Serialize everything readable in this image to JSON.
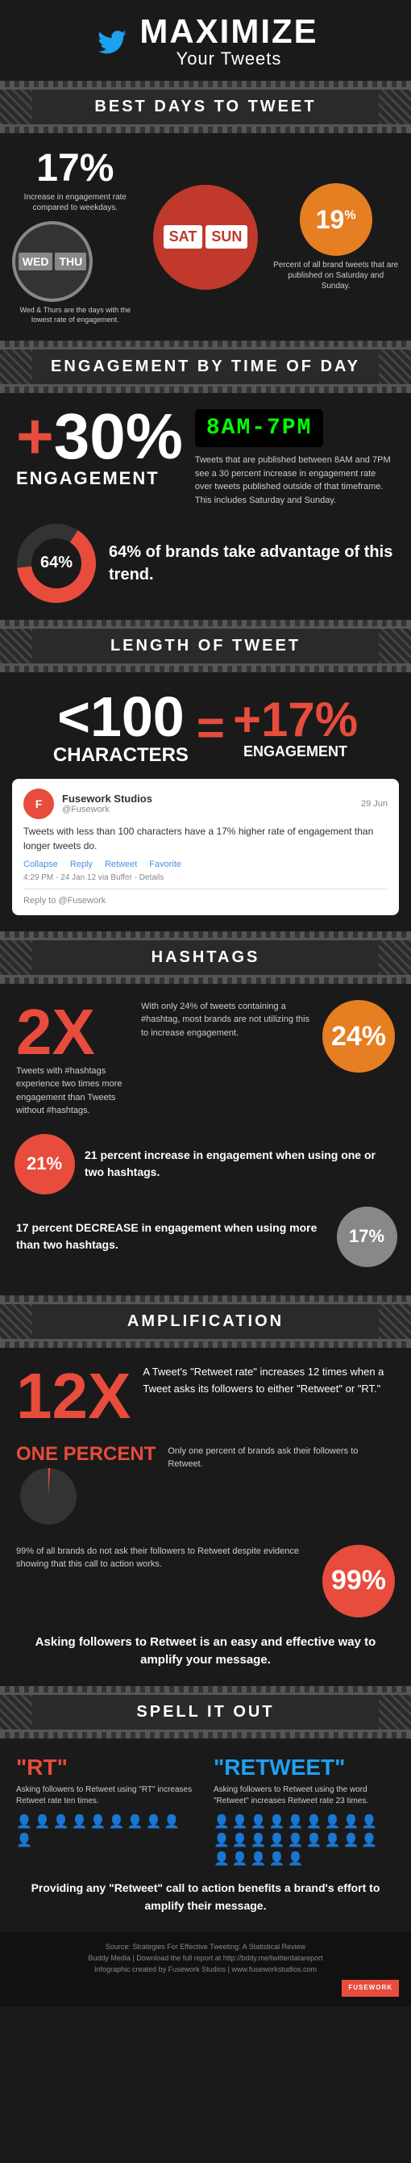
{
  "header": {
    "title": "MAXIMIZE",
    "subtitle": "Your Tweets"
  },
  "sections": {
    "best_days": {
      "banner": "BEST DAYS TO TWEET",
      "stat1_pct": "17%",
      "stat1_label": "Increase in engagement rate compared to weekdays.",
      "days_highlight": [
        "SAT",
        "SUN"
      ],
      "days_low": [
        "WED",
        "THU"
      ],
      "low_label": "Wed & Thurs are the days with the lowest rate of engagement.",
      "stat2_pct": "19%",
      "stat2_label": "Percent of all brand tweets that are published on Saturday and Sunday."
    },
    "engagement_time": {
      "banner": "ENGAGEMENT BY TIME OF DAY",
      "plus": "+",
      "pct": "30%",
      "label": "ENGAGEMENT",
      "time_range": "8AM-7PM",
      "desc": "Tweets that are published between 8AM and 7PM see a 30 percent increase in engagement rate over tweets published outside of that timeframe. This includes Saturday and Sunday.",
      "brands_pct": "64%",
      "brands_text": "64% of brands take advantage of this trend."
    },
    "length": {
      "banner": "LENGTH OF TWEET",
      "chars": "<100",
      "chars_label": "CHARACTERS",
      "equals": "=",
      "engagement": "+17%",
      "engagement_label": "ENGAGEMENT",
      "tweet": {
        "name": "Fusework Studios",
        "handle": "@Fusework",
        "date": "29 Jun",
        "body": "Tweets with less than 100 characters have a 17% higher rate of engagement than longer tweets do.",
        "actions": [
          "Collapse",
          "Reply",
          "Retweet",
          "Favorite"
        ],
        "time": "4:29 PM - 24 Jan 12 via Buffer - Details",
        "reply_placeholder": "Reply to @Fusework"
      }
    },
    "hashtags": {
      "banner": "HASHTAGS",
      "two_x": "2X",
      "two_x_desc": "Tweets with #hashtags experience two times more engagement than Tweets without #hashtags.",
      "only_24_desc": "With only 24% of tweets containing a #hashtag, most brands are not utilizing this to increase engagement.",
      "pct_24": "24%",
      "arrow_up_pct": "21%",
      "arrow_up_text": "21 percent increase in engagement when using one or two hashtags.",
      "arrow_down_pct": "17%",
      "arrow_down_text": "17 percent DECREASE in engagement when using more than two hashtags."
    },
    "amplification": {
      "banner": "AMPLIFICATION",
      "twelve_x": "12X",
      "amp_desc": "A Tweet's \"Retweet rate\" increases 12 times when a Tweet asks its followers to either \"Retweet\" or \"RT.\"",
      "one_percent_label": "ONE PERCENT",
      "one_percent_desc": "Only one percent of brands ask their followers to Retweet.",
      "ninety_nine_pct": "99%",
      "ninety_nine_desc": "99% of all brands do not ask their followers to Retweet despite evidence showing that this call to action works.",
      "cta_text": "Asking followers to Retweet is an easy and effective way to amplify your message."
    },
    "spell_it_out": {
      "banner": "SPELL IT OUT",
      "term_rt": "\"RT\"",
      "rt_desc": "Asking followers to Retweet using \"RT\" increases Retweet rate ten times.",
      "term_retweet": "\"RETWEET\"",
      "retweet_desc": "Asking followers to Retweet using the word \"Retweet\" increases Retweet rate 23 times.",
      "rt_multiplier": 10,
      "retweet_multiplier": 23,
      "bottom_text": "Providing any \"Retweet\" call to action benefits a brand's effort to amplify their message."
    }
  },
  "footer": {
    "source": "Source: Strategies For Effective Tweeting: A Statistical Review",
    "buddy_media": "Buddy Media | Download the full report at http://bddy.me/twitterdatareport",
    "credit": "Infographic created by Fusework Studios | www.fuseworkstudios.com"
  }
}
